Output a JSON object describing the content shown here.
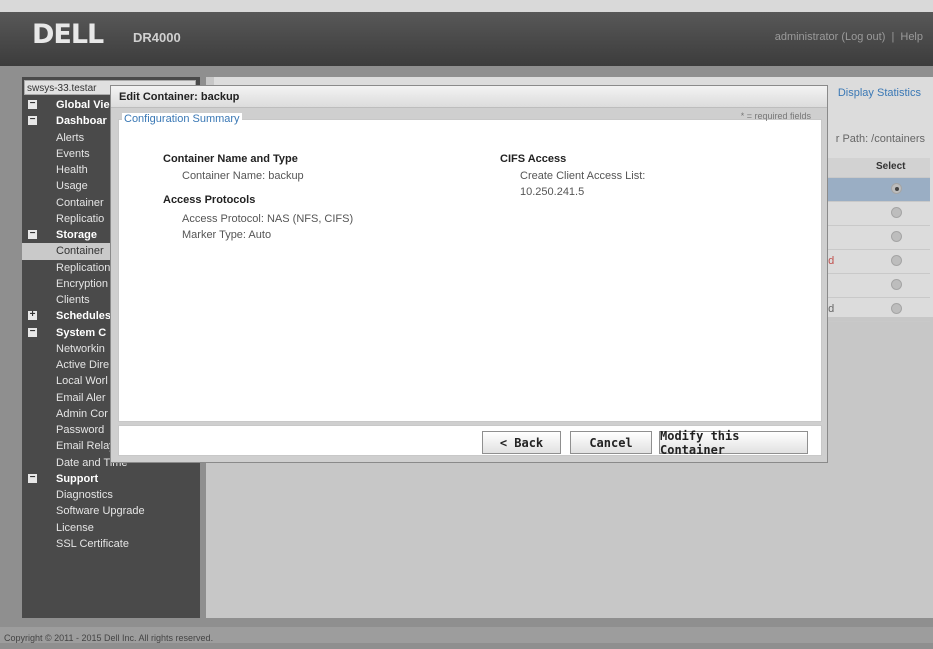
{
  "header": {
    "logo_text": "DELL",
    "product": "DR4000",
    "user": "administrator",
    "logout": "(Log out)",
    "separator": "|",
    "help": "Help"
  },
  "sidebar": {
    "system_select": "swsys-33.testar",
    "items": [
      {
        "label": "Global Vie",
        "type": "group",
        "toggle": "−"
      },
      {
        "label": "Dashboar",
        "type": "group",
        "toggle": "−"
      },
      {
        "label": "Alerts",
        "type": "child"
      },
      {
        "label": "Events",
        "type": "child"
      },
      {
        "label": "Health",
        "type": "child"
      },
      {
        "label": "Usage",
        "type": "child"
      },
      {
        "label": "Container",
        "type": "child"
      },
      {
        "label": "Replicatio",
        "type": "child"
      },
      {
        "label": "Storage",
        "type": "group",
        "toggle": "−"
      },
      {
        "label": "Container",
        "type": "child",
        "selected": true
      },
      {
        "label": "Replication",
        "type": "child"
      },
      {
        "label": "Encryption",
        "type": "child"
      },
      {
        "label": "Clients",
        "type": "child"
      },
      {
        "label": "Schedules",
        "type": "group",
        "toggle": "+"
      },
      {
        "label": "System C",
        "type": "group",
        "toggle": "−"
      },
      {
        "label": "Networkin",
        "type": "child"
      },
      {
        "label": "Active Dire",
        "type": "child"
      },
      {
        "label": "Local Worl",
        "type": "child"
      },
      {
        "label": "Email Aler",
        "type": "child"
      },
      {
        "label": "Admin Cor",
        "type": "child"
      },
      {
        "label": "Password",
        "type": "child"
      },
      {
        "label": "Email Relay Host",
        "type": "child"
      },
      {
        "label": "Date and Time",
        "type": "child"
      },
      {
        "label": "Support",
        "type": "group",
        "toggle": "−"
      },
      {
        "label": "Diagnostics",
        "type": "child"
      },
      {
        "label": "Software Upgrade",
        "type": "child"
      },
      {
        "label": "License",
        "type": "child"
      },
      {
        "label": "SSL Certificate",
        "type": "child"
      }
    ]
  },
  "background": {
    "display_statistics": "Display Statistics",
    "folder_path": "r Path: /containers",
    "table": {
      "status_header": "",
      "select_header": "Select",
      "rows": [
        {
          "status": "",
          "selected": true
        },
        {
          "status": "",
          "selected": false
        },
        {
          "status": "",
          "selected": false
        },
        {
          "status": "ed",
          "selected": false,
          "red": true
        },
        {
          "status": "",
          "selected": false
        },
        {
          "status": "ed",
          "selected": false
        }
      ]
    }
  },
  "dialog": {
    "title": "Edit Container: backup",
    "required_note": "* = required fields",
    "legend": "Configuration Summary",
    "sections": {
      "name_type": {
        "heading": "Container Name and Type",
        "container_name": "Container Name: backup"
      },
      "access_protocols": {
        "heading": "Access Protocols",
        "access_protocol": "Access Protocol: NAS (NFS, CIFS)",
        "marker_type": "Marker Type: Auto"
      },
      "cifs": {
        "heading": "CIFS Access",
        "client_list_label": "Create Client Access List:",
        "client_ip": "10.250.241.5"
      }
    },
    "buttons": {
      "back": "< Back",
      "cancel": "Cancel",
      "modify": "Modify this Container"
    }
  },
  "footer": {
    "copyright": "Copyright © 2011 - 2015 Dell Inc. All rights reserved."
  }
}
